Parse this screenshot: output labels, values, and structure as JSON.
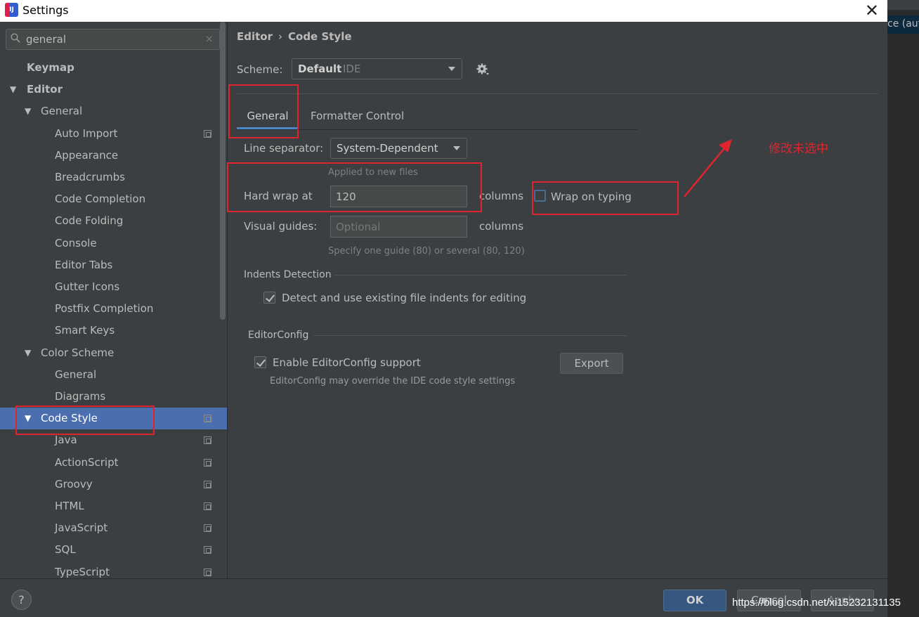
{
  "window": {
    "title": "Settings",
    "app_icon": "IJ"
  },
  "background_window": {
    "text": "ce (aut"
  },
  "search": {
    "value": "general",
    "clear": "×"
  },
  "tree": [
    {
      "label": "Keymap",
      "bold": true,
      "level": 0,
      "arrow": false
    },
    {
      "label": "Editor",
      "bold": true,
      "level": 0,
      "arrow": true
    },
    {
      "label": "General",
      "level": 1,
      "arrow": true
    },
    {
      "label": "Auto Import",
      "level": 2,
      "copy": true
    },
    {
      "label": "Appearance",
      "level": 2
    },
    {
      "label": "Breadcrumbs",
      "level": 2
    },
    {
      "label": "Code Completion",
      "level": 2
    },
    {
      "label": "Code Folding",
      "level": 2
    },
    {
      "label": "Console",
      "level": 2
    },
    {
      "label": "Editor Tabs",
      "level": 2
    },
    {
      "label": "Gutter Icons",
      "level": 2
    },
    {
      "label": "Postfix Completion",
      "level": 2
    },
    {
      "label": "Smart Keys",
      "level": 2
    },
    {
      "label": "Color Scheme",
      "level": 1,
      "arrow": true
    },
    {
      "label": "General",
      "level": 2
    },
    {
      "label": "Diagrams",
      "level": 2
    },
    {
      "label": "Code Style",
      "level": 1,
      "arrow": true,
      "selected": true,
      "copy": true
    },
    {
      "label": "Java",
      "level": 2,
      "copy": true
    },
    {
      "label": "ActionScript",
      "level": 2,
      "copy": true
    },
    {
      "label": "Groovy",
      "level": 2,
      "copy": true
    },
    {
      "label": "HTML",
      "level": 2,
      "copy": true
    },
    {
      "label": "JavaScript",
      "level": 2,
      "copy": true
    },
    {
      "label": "SQL",
      "level": 2,
      "copy": true
    },
    {
      "label": "TypeScript",
      "level": 2,
      "copy": true
    }
  ],
  "breadcrumb": {
    "part1": "Editor",
    "sep": "›",
    "part2": "Code Style"
  },
  "scheme": {
    "label": "Scheme:",
    "value": "Default",
    "sub": "IDE"
  },
  "tabs": {
    "general": "General",
    "formatter": "Formatter Control"
  },
  "form": {
    "line_separator_label": "Line separator:",
    "line_separator_value": "System-Dependent",
    "applied_hint": "Applied to new files",
    "hard_wrap_label": "Hard wrap at",
    "hard_wrap_value": "120",
    "columns1": "columns",
    "wrap_on_typing": "Wrap on typing",
    "visual_guides_label": "Visual guides:",
    "visual_guides_placeholder": "Optional",
    "columns2": "columns",
    "guides_hint": "Specify one guide (80) or several (80, 120)"
  },
  "indents": {
    "title": "Indents Detection",
    "detect_label": "Detect and use existing file indents for editing",
    "detect_checked": true
  },
  "editorconfig": {
    "title": "EditorConfig",
    "enable_label": "Enable EditorConfig support",
    "enable_checked": true,
    "hint": "EditorConfig may override the IDE code style settings",
    "export": "Export"
  },
  "annotation": {
    "text": "修改未选中",
    "color": "#e0242e"
  },
  "footer": {
    "help": "?",
    "ok": "OK",
    "cancel": "Cancel",
    "apply": "Apply",
    "watermark": "https://blog.csdn.net/xi15232131135"
  }
}
